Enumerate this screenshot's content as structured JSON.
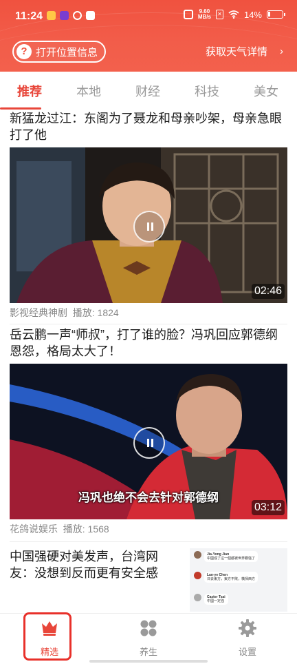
{
  "status_bar": {
    "time": "11:24",
    "net_speed_value": "9.60",
    "net_speed_unit": "MB/s",
    "battery_percent": "14%",
    "battery_level": 0.14
  },
  "header": {
    "location_button_label": "打开位置信息",
    "location_icon_glyph": "?",
    "weather_label": "获取天气详情",
    "weather_chevron": "›",
    "accent_color": "#f0523f"
  },
  "tabs": [
    {
      "label": "推荐",
      "active": true
    },
    {
      "label": "本地",
      "active": false
    },
    {
      "label": "财经",
      "active": false
    },
    {
      "label": "科技",
      "active": false
    },
    {
      "label": "美女",
      "active": false
    }
  ],
  "articles": [
    {
      "title": "新猛龙过江：东阁为了聂龙和母亲吵架，母亲急眼打了他",
      "duration": "02:46",
      "source": "影视经典神剧",
      "plays": "播放: 1824"
    },
    {
      "title": "岳云鹏一声“师叔”，打了谁的脸？冯巩回应郭德纲恩怨，格局太大了！",
      "duration": "03:12",
      "subtitle": "冯巩也绝不会去针对郭德纲",
      "source": "花鸽说娱乐",
      "plays": "播放: 1568"
    },
    {
      "title": "中国强硬对美发声，台湾网友：没想到反而更有安全感",
      "thumb_chat": [
        {
          "name": "Jia-Yong Jian",
          "text": "中國成了這一個都被世界霸強了"
        },
        {
          "name": "Lan-ye Chen",
          "text": "日去東方，東方不敗，橫掃西方"
        },
        {
          "name": "Caster Tsai",
          "text": "中國一定強"
        }
      ]
    }
  ],
  "bottom_nav": [
    {
      "label": "精选",
      "icon": "crown-icon",
      "active": true
    },
    {
      "label": "养生",
      "icon": "grid-icon",
      "active": false
    },
    {
      "label": "设置",
      "icon": "gear-icon",
      "active": false
    }
  ]
}
